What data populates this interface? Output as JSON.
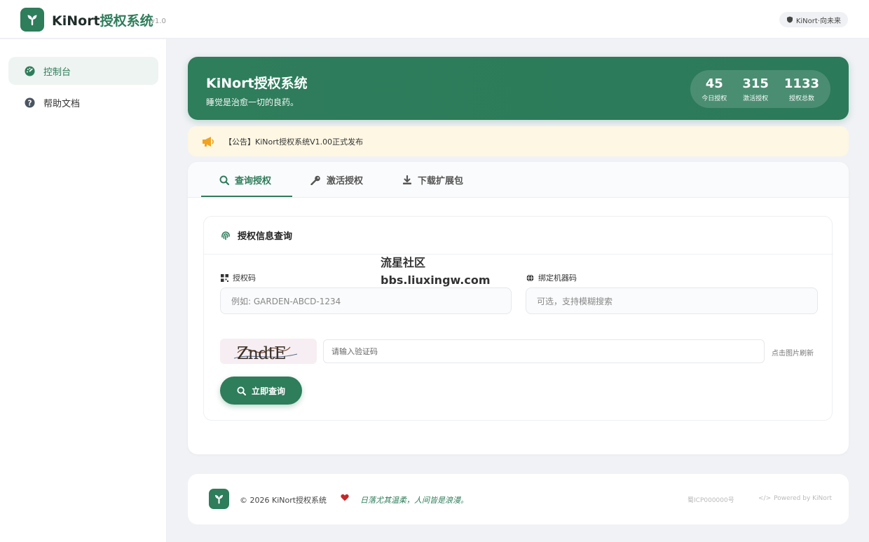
{
  "app": {
    "brand_prefix": "KiNort",
    "brand_suffix": "授权系统",
    "version": "v1.0",
    "top_right_label": "KiNort·向未来"
  },
  "sidebar": {
    "items": [
      {
        "label": "控制台",
        "icon": "dashboard-icon",
        "active": true
      },
      {
        "label": "帮助文档",
        "icon": "question-icon",
        "active": false
      }
    ]
  },
  "hero": {
    "title": "KiNort授权系统",
    "subtitle": "睡觉是治愈一切的良药。",
    "stats": [
      {
        "value": "45",
        "label": "今日授权"
      },
      {
        "value": "315",
        "label": "激活授权"
      },
      {
        "value": "1133",
        "label": "授权总数"
      }
    ]
  },
  "notice": {
    "icon": "megaphone-icon",
    "text": "【公告】KiNort授权系统V1.00正式发布"
  },
  "tabs": [
    {
      "label": "查询授权",
      "icon": "search-icon",
      "active": true
    },
    {
      "label": "激活授权",
      "icon": "key-icon",
      "active": false
    },
    {
      "label": "下载扩展包",
      "icon": "download-icon",
      "active": false
    }
  ],
  "query_panel": {
    "title": "授权信息查询",
    "license_label": "授权码",
    "license_placeholder": "例如: GARDEN-ABCD-1234",
    "machine_label": "绑定机器码",
    "machine_placeholder": "可选，支持模糊搜索",
    "captcha_text": "ZndtE",
    "captcha_placeholder": "请输入验证码",
    "refresh_hint": "点击图片刷新",
    "submit_label": "立即查询"
  },
  "watermark": {
    "line1": "流星社区",
    "line2": "bbs.liuxingw.com"
  },
  "footer": {
    "copyright": "© 2026 KiNort授权系统",
    "motto": "日落尤其温柔，人间皆是浪漫。",
    "icp": "蜀ICP000000号",
    "powered": "Powered by KiNort"
  },
  "colors": {
    "accent": "#2e7d5b",
    "notice_bg": "#fdf7e3",
    "notice_icon": "#f0a21f",
    "heart": "#c62828"
  }
}
